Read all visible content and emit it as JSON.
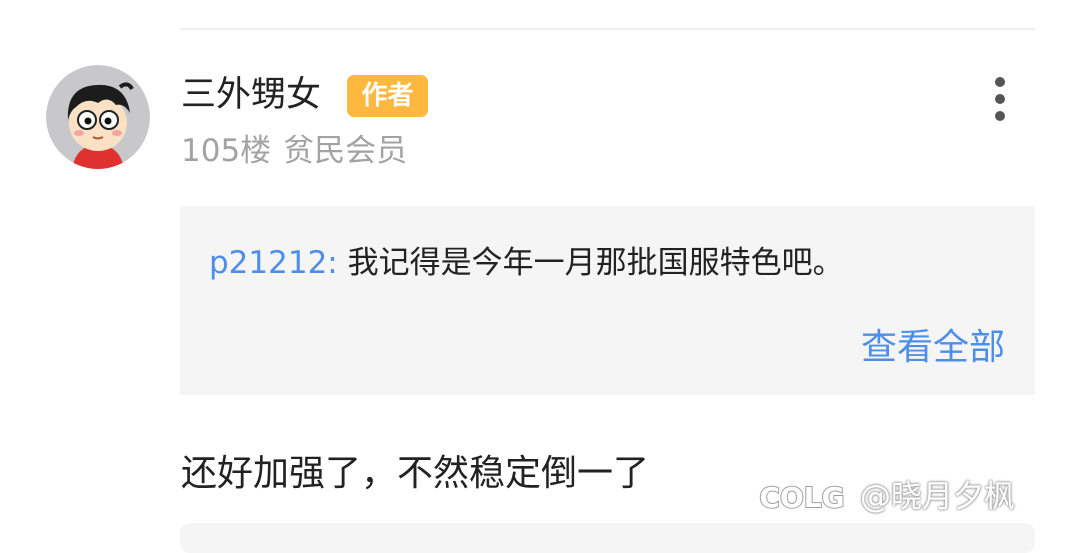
{
  "post": {
    "username": "三外甥女",
    "author_badge": "作者",
    "floor": "105楼",
    "member_level": "贫民会员",
    "quote": {
      "author": "p21212:",
      "text": "我记得是今年一月那批国服特色吧。",
      "view_all_label": "查看全部"
    },
    "content": "还好加强了，不然稳定倒一了"
  },
  "watermark": {
    "text": "@晓月夕枫",
    "logo": "COLG"
  },
  "colors": {
    "link": "#4d8fe8",
    "badge": "#ffb83f",
    "muted": "#a3a3a3",
    "quote_bg": "#f5f5f5"
  },
  "icons": {
    "more": "more-vertical-icon"
  }
}
